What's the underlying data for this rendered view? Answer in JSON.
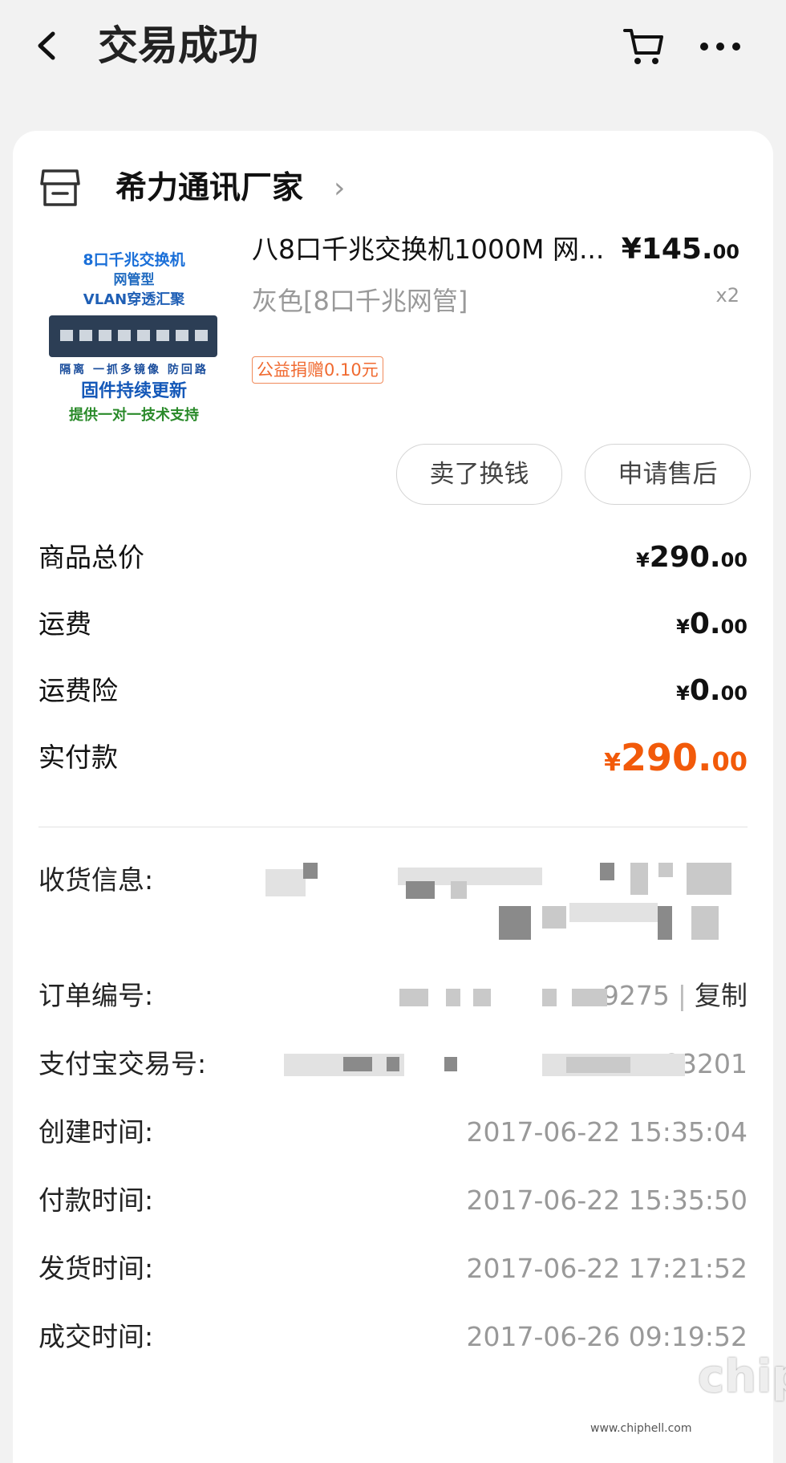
{
  "header": {
    "title": "交易成功"
  },
  "shop": {
    "name": "希力通讯厂家"
  },
  "product": {
    "image_lines": [
      "8口千兆交换机",
      "网管型",
      "VLAN穿透汇聚",
      "隔离  一抓多镜像  防回路",
      "固件持续更新",
      "提供一对一技术支持"
    ],
    "name": "八8口千兆交换机1000M 网...",
    "spec": "灰色[8口千兆网管]",
    "price_main": "¥145.",
    "price_cents": "00",
    "quantity": "x2",
    "donation": "公益捐赠0.10元"
  },
  "actions": {
    "sell": "卖了换钱",
    "after_sale": "申请售后"
  },
  "summary": {
    "total": {
      "label": "商品总价",
      "currency": "¥",
      "main": "290.",
      "cents": "00"
    },
    "shipping": {
      "label": "运费",
      "currency": "¥",
      "main": "0.",
      "cents": "00"
    },
    "insurance": {
      "label": "运费险",
      "currency": "¥",
      "main": "0.",
      "cents": "00"
    },
    "paid": {
      "label": "实付款",
      "currency": "¥",
      "main": "290.",
      "cents": "00"
    }
  },
  "info": {
    "address_label": "收货信息:",
    "order_no_label": "订单编号:",
    "order_no_tail": "9275",
    "copy_label": "复制",
    "alipay_label": "支付宝交易号:",
    "alipay_tail": "83201",
    "created_label": "创建时间:",
    "created": "2017-06-22 15:35:04",
    "paid_label": "付款时间:",
    "paid": "2017-06-22 15:35:50",
    "shipped_label": "发货时间:",
    "shipped": "2017-06-22 17:21:52",
    "done_label": "成交时间:",
    "done": "2017-06-26 09:19:52"
  },
  "watermark": {
    "site": "www.chiphell.com",
    "logo_text": "chip"
  },
  "colors": {
    "accent": "#f25a0a",
    "background": "#f2f2f2"
  },
  "icons": [
    "back-icon",
    "cart-icon",
    "more-icon",
    "shop-icon",
    "chevron-right-icon"
  ]
}
